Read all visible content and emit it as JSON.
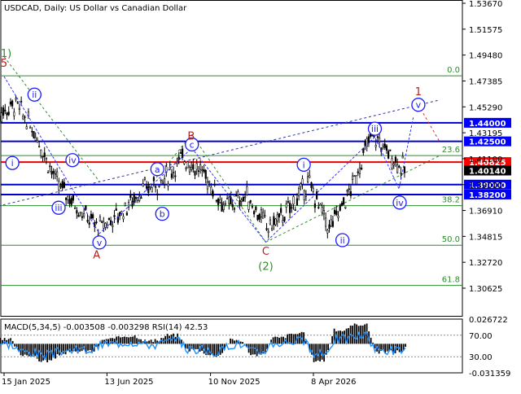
{
  "title": "USDCAD, Daily:  US Dollar vs Canadian Dollar",
  "chart_data": {
    "type": "candlestick",
    "symbol": "USDCAD",
    "timeframe": "Daily",
    "instrument_name": "US Dollar vs Canadian Dollar",
    "ylim": [
      1.2935,
      1.5367
    ],
    "price_ticks": [
      "1.53670",
      "1.51575",
      "1.49480",
      "1.47385",
      "1.45290",
      "1.43195",
      "1.41100",
      "1.39000",
      "1.36910",
      "1.34815",
      "1.32720",
      "1.30625"
    ],
    "x_ticks": [
      "15 Jan 2025",
      "13 Jun 2025",
      "10 Nov 2025",
      "8 Apr 2026"
    ],
    "grid": false,
    "horizontal_levels": [
      {
        "label": "1.44000",
        "value": 1.44,
        "color": "#0000cc",
        "label_bg": "#0000ff"
      },
      {
        "label": "1.42500",
        "value": 1.425,
        "color": "#0000cc",
        "label_bg": "#0000ff"
      },
      {
        "label": "1.40825",
        "value": 1.40825,
        "color": "#ee0000",
        "label_bg": "#ff0000"
      },
      {
        "label": "1.40140",
        "value": 1.4014,
        "color": null,
        "label_bg": "#000000"
      },
      {
        "label": "1.39000",
        "value": 1.39,
        "color": "#0000cc",
        "label_bg": "#0000ff"
      },
      {
        "label": "1.38200",
        "value": 1.382,
        "color": "#0000cc",
        "label_bg": "#0000ff"
      }
    ],
    "fibonacci_levels": [
      {
        "label": "0.0",
        "value": 1.478
      },
      {
        "label": "23.6",
        "value": 1.4135
      },
      {
        "label": "38.2",
        "value": 1.373
      },
      {
        "label": "50.0",
        "value": 1.341
      },
      {
        "label": "61.8",
        "value": 1.3085
      }
    ],
    "wave_labels": [
      {
        "text": "(1)",
        "style": "green-paren",
        "date": "2025-01-15",
        "price": 1.4965
      },
      {
        "text": "5",
        "style": "red",
        "date": "2025-01-15",
        "price": 1.4885
      },
      {
        "text": "ii",
        "style": "circle-blue",
        "date": "2025-02-28",
        "price": 1.4628
      },
      {
        "text": "i",
        "style": "circle-blue",
        "date": "2025-01-27",
        "price": 1.4075
      },
      {
        "text": "iv",
        "style": "circle-blue",
        "date": "2025-04-24",
        "price": 1.4098
      },
      {
        "text": "iii",
        "style": "circle-blue",
        "date": "2025-04-04",
        "price": 1.3713
      },
      {
        "text": "v",
        "style": "circle-blue",
        "date": "2025-06-02",
        "price": 1.3432
      },
      {
        "text": "A",
        "style": "red",
        "date": "2025-05-29",
        "price": 1.3337
      },
      {
        "text": "a",
        "style": "circle-blue",
        "date": "2025-08-25",
        "price": 1.4025
      },
      {
        "text": "b",
        "style": "circle-blue",
        "date": "2025-09-01",
        "price": 1.3664
      },
      {
        "text": "c",
        "style": "circle-blue",
        "date": "2025-10-14",
        "price": 1.4225
      },
      {
        "text": "B",
        "style": "red",
        "date": "2025-10-13",
        "price": 1.4298
      },
      {
        "text": "C",
        "style": "red",
        "date": "2026-01-29",
        "price": 1.3366
      },
      {
        "text": "(2)",
        "style": "green-paren",
        "date": "2026-01-29",
        "price": 1.3245
      },
      {
        "text": "i",
        "style": "circle-blue",
        "date": "2026-03-25",
        "price": 1.4061
      },
      {
        "text": "ii",
        "style": "circle-blue",
        "date": "2026-05-20",
        "price": 1.3451
      },
      {
        "text": "iii",
        "style": "circle-blue",
        "date": "2026-07-06",
        "price": 1.4352
      },
      {
        "text": "iv",
        "style": "circle-blue",
        "date": "2026-08-11",
        "price": 1.3755
      },
      {
        "text": "v",
        "style": "circle-blue",
        "date": "2026-09-07",
        "price": 1.4546
      },
      {
        "text": "1",
        "style": "red",
        "date": "2026-09-07",
        "price": 1.4657
      }
    ],
    "wave_path_points": [
      {
        "date": "2025-01-15",
        "price": 1.4775
      },
      {
        "date": "2025-06-02",
        "price": 1.3505
      },
      {
        "date": "2025-10-14",
        "price": 1.4195
      },
      {
        "date": "2026-01-29",
        "price": 1.3435
      },
      {
        "date": "2026-07-06",
        "price": 1.4285
      },
      {
        "date": "2026-08-10",
        "price": 1.3865
      },
      {
        "date": "2026-08-31",
        "price": 1.4455
      }
    ],
    "channel_lines": [
      {
        "from": {
          "date": "2025-01-15",
          "price": 1.4935
        },
        "to": {
          "date": "2025-06-02",
          "price": 1.3925
        }
      },
      {
        "from": {
          "date": "2024-12-24",
          "price": 1.3708
        },
        "to": {
          "date": "2026-10-08",
          "price": 1.4585
        }
      },
      {
        "from": {
          "date": "2025-08-01",
          "price": 1.3805
        },
        "to": {
          "date": "2025-10-14",
          "price": 1.4305
        }
      },
      {
        "from": {
          "date": "2025-10-14",
          "price": 1.4305
        },
        "to": {
          "date": "2026-01-29",
          "price": 1.3435
        }
      },
      {
        "from": {
          "date": "2026-01-29",
          "price": 1.3435
        },
        "to": {
          "date": "2026-10-08",
          "price": 1.4135
        }
      },
      {
        "from": {
          "date": "2026-09-07",
          "price": 1.4546
        },
        "to": {
          "date": "2026-10-08",
          "price": 1.4245
        }
      }
    ],
    "price_series": {
      "dates": [
        "2025-01-01",
        "2025-02-01",
        "2025-03-01",
        "2025-04-01",
        "2025-05-01",
        "2025-06-01",
        "2025-07-01",
        "2025-08-01",
        "2025-09-01",
        "2025-10-01",
        "2025-11-01",
        "2025-12-01",
        "2026-01-01",
        "2026-02-01",
        "2026-03-01",
        "2026-04-01",
        "2026-05-01",
        "2026-06-01",
        "2026-07-01",
        "2026-08-01",
        "2026-08-20"
      ],
      "prices": [
        1.445,
        1.455,
        1.432,
        1.392,
        1.372,
        1.355,
        1.366,
        1.385,
        1.392,
        1.412,
        1.398,
        1.372,
        1.381,
        1.355,
        1.368,
        1.392,
        1.354,
        1.386,
        1.431,
        1.412,
        1.401
      ]
    },
    "indicator": {
      "header": "MACD(5,34,5) -0.003508 -0.003298 RSI(14) 42.53",
      "name": "MACD(5,34,5)",
      "macd": -0.003508,
      "signal": -0.003298,
      "rsi_name": "RSI(14)",
      "rsi": 42.53,
      "ticks": [
        "0.026722",
        "70.00",
        "30.00",
        "-0.031359"
      ],
      "macd_ylim": [
        -0.031359,
        0.026722
      ],
      "rsi_levels": [
        70,
        30
      ]
    }
  }
}
